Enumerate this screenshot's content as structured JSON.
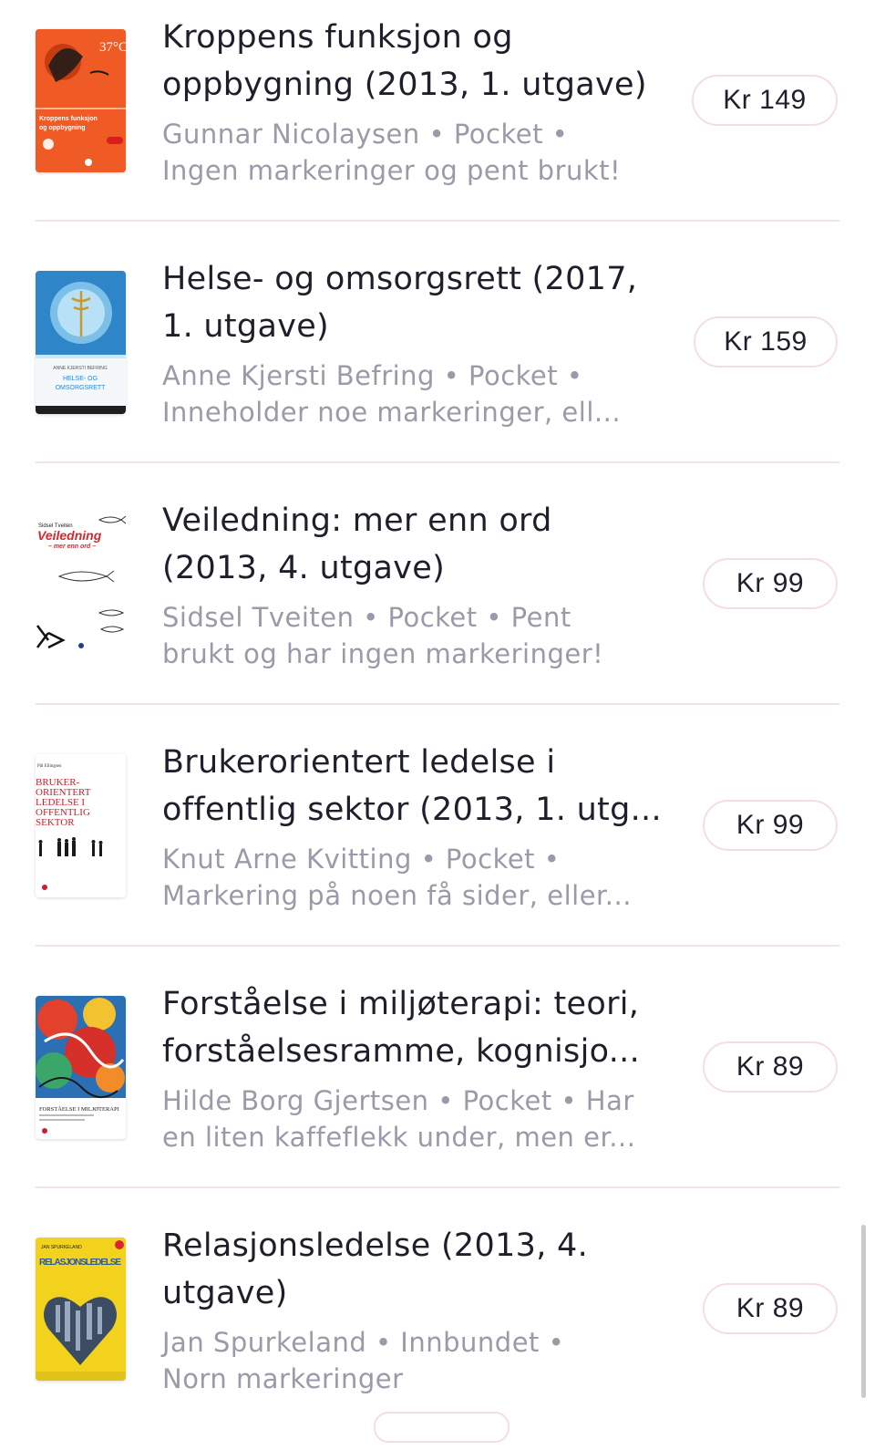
{
  "listings": [
    {
      "title_line1": "Kroppens funksjon og",
      "title_line2": "oppbygning (2013, 1. utgave)",
      "meta_line1": "Gunnar Nicolaysen • Pocket •",
      "meta_line2": "Ingen markeringer og pent brukt!",
      "price": "Kr 149",
      "cover_text": "Kroppens funksjon og oppbygning",
      "cover_badge": "37°C",
      "cover_color": "#f05a24"
    },
    {
      "title_line1": "Helse- og omsorgsrett (2017,",
      "title_line2": "1. utgave)",
      "meta_line1": "Anne Kjersti Befring • Pocket •",
      "meta_line2": "Inneholder noe markeringer, ell...",
      "price": "Kr 159",
      "cover_author": "ANNE KJERSTI BEFRING",
      "cover_text_line1": "HELSE- OG",
      "cover_text_line2": "OMSORGSRETT",
      "cover_color": "#3a8fd0"
    },
    {
      "title_line1": "Veiledning: mer enn ord",
      "title_line2": "(2013, 4. utgave)",
      "meta_line1": "Sidsel Tveiten • Pocket • Pent",
      "meta_line2": "brukt og har ingen markeringer!",
      "price": "Kr 99",
      "cover_author": "Sidsel Tveiten",
      "cover_text": "Veiledning",
      "cover_subtext": "– mer enn ord –",
      "cover_color": "#d9262c"
    },
    {
      "title_line1": "Brukerorientert ledelse i",
      "title_line2": "offentlig sektor (2013, 1. utg...",
      "meta_line1": "Knut Arne Kvitting • Pocket •",
      "meta_line2": "Markering på noen få sider, eller...",
      "price": "Kr 99",
      "cover_author": "Pål Ellingsen",
      "cover_text_lines": [
        "BRUKER-",
        "ORIENTERT",
        "LEDELSE I",
        "OFFENTLIG",
        "SEKTOR"
      ],
      "cover_color": "#c8202a"
    },
    {
      "title_line1": "Forståelse i miljøterapi: teori,",
      "title_line2": "forståelsesramme, kognisjo...",
      "meta_line1": "Hilde Borg Gjertsen • Pocket • Har",
      "meta_line2": "en liten kaffeflekk under, men er...",
      "price": "Kr 89",
      "cover_text": "FORSTÅELSE I MILJØTERAPI"
    },
    {
      "title_line1": "Relasjonsledelse (2013, 4.",
      "title_line2": "utgave)",
      "meta_line1": "Jan Spurkeland • Innbundet •",
      "meta_line2": "Norn markeringer",
      "price": "Kr 89",
      "cover_author": "JAN SPURKELAND",
      "cover_text": "RELASJONSLEDELSE",
      "cover_color": "#f2d21c"
    }
  ]
}
